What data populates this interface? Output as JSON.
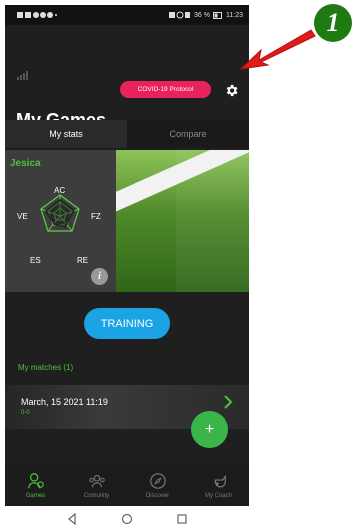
{
  "status_bar": {
    "battery": "36 %",
    "time": "11:23"
  },
  "header": {
    "covid_button": "COVID-19 Protocol",
    "title": "My Games"
  },
  "tabs": [
    {
      "label": "My stats",
      "active": true
    },
    {
      "label": "Compare",
      "active": false
    }
  ],
  "stats": {
    "player": "Jesica",
    "radar_labels": {
      "ac": "AC",
      "ve": "VE",
      "fz": "FZ",
      "es": "ES",
      "re": "RE"
    },
    "info_glyph": "i"
  },
  "training_button": "TRAINING",
  "matches": {
    "label": "My matches (1)",
    "items": [
      {
        "date": "March, 15 2021 11:19",
        "score": "0-0"
      }
    ]
  },
  "fab_label": "+",
  "bottom_nav": [
    {
      "label": "Games",
      "icon": "games-icon",
      "active": true
    },
    {
      "label": "Comunity",
      "icon": "community-icon",
      "active": false
    },
    {
      "label": "Discover",
      "icon": "compass-icon",
      "active": false
    },
    {
      "label": "My Coach",
      "icon": "whistle-icon",
      "active": false
    }
  ],
  "annotation": {
    "number": "1"
  },
  "colors": {
    "accent_green": "#4fbf3f",
    "covid_pink": "#e8225d",
    "training_blue": "#1aa3e5",
    "fab_green": "#3bb54a",
    "annotation_red": "#e01b1b"
  }
}
